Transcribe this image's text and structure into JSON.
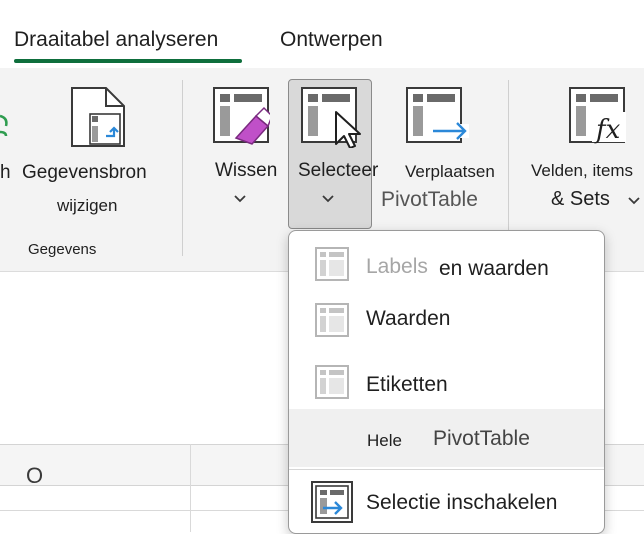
{
  "tabs": {
    "active": "Draaitabel analyseren",
    "second": "Ontwerpen"
  },
  "ribbon": {
    "partial_left_text": "h",
    "gegevensbron": {
      "line1": "Gegevensbron",
      "line2": "wijzigen"
    },
    "group_label": "Gegevens",
    "wissen": "Wissen",
    "selecteer": "Selecteer",
    "verplaatsen": "Verplaatsen",
    "pivottable": "PivotTable",
    "velden": {
      "line1": "Velden, items",
      "line2": "& Sets"
    }
  },
  "sheet": {
    "column_header": "O"
  },
  "menu": {
    "items": [
      {
        "label_a": "Labels",
        "label_b": "en waarden",
        "icon": "table-select-icon"
      },
      {
        "label": "Waarden",
        "icon": "table-values-icon"
      },
      {
        "label": "Etiketten",
        "icon": "table-labels-icon"
      },
      {
        "label_a": "Hele",
        "label_b": "PivotTable"
      },
      {
        "label": "Selectie inschakelen",
        "icon": "enable-selection-icon"
      }
    ]
  },
  "colors": {
    "accent": "#0e6e3c",
    "ribbon_bg": "#f3f3f3",
    "icon_blue": "#2b88d8",
    "eraser_purple": "#b040b8"
  }
}
